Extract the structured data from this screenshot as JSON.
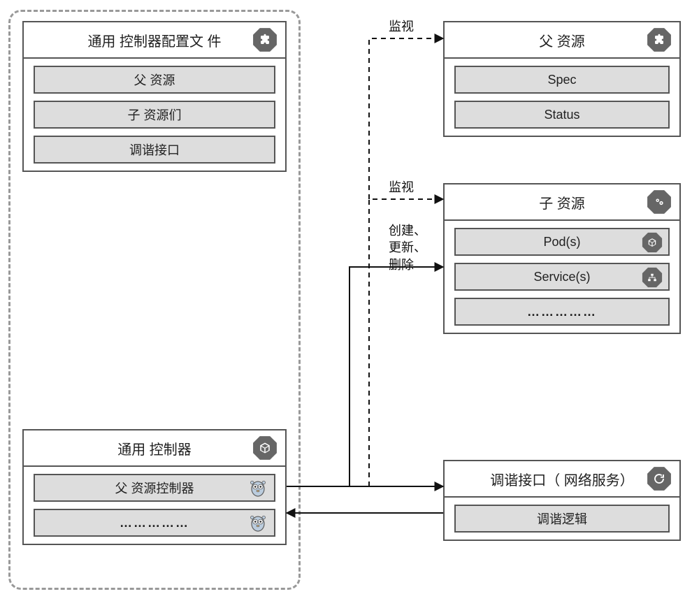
{
  "left": {
    "config_box": {
      "title": "通用 控制器配置文 件",
      "items": [
        "父 资源",
        "子 资源们",
        "调谐接口"
      ],
      "icon": "puzzle-icon"
    },
    "controller_box": {
      "title": "通用 控制器",
      "items": [
        "父 资源控制器",
        "……………"
      ],
      "icon": "cube-icon",
      "item_icon": "gopher-icon"
    }
  },
  "right": {
    "parent_box": {
      "title": "父 资源",
      "items": [
        "Spec",
        "Status"
      ],
      "icon": "puzzle-icon"
    },
    "child_box": {
      "title": "子 资源",
      "items": [
        "Pod(s)",
        "Service(s)",
        "……………"
      ],
      "icon": "gear-icon",
      "item_icons": [
        "cube-icon",
        "sitemap-icon",
        null
      ]
    },
    "tuning_box": {
      "title": "调谐接口（ 网络服务）",
      "items": [
        "调谐逻辑"
      ],
      "icon": "refresh-icon"
    }
  },
  "edges": {
    "watch_parent": "监视",
    "watch_child": "监视",
    "crud_child": "创建、\n更新、\n删除"
  },
  "chart_data": {
    "type": "diagram",
    "nodes": [
      {
        "id": "config",
        "label": "通用控制器配置文件",
        "fields": [
          "父资源",
          "子资源们",
          "调谐接口"
        ]
      },
      {
        "id": "controller",
        "label": "通用控制器",
        "fields": [
          "父资源控制器",
          "…"
        ]
      },
      {
        "id": "parent_res",
        "label": "父资源",
        "fields": [
          "Spec",
          "Status"
        ]
      },
      {
        "id": "child_res",
        "label": "子资源",
        "fields": [
          "Pod(s)",
          "Service(s)",
          "…"
        ]
      },
      {
        "id": "tuning_if",
        "label": "调谐接口（网络服务）",
        "fields": [
          "调谐逻辑"
        ]
      }
    ],
    "container": {
      "id": "dashed_group",
      "children": [
        "config",
        "controller"
      ]
    },
    "edges": [
      {
        "from": "controller",
        "to": "parent_res",
        "label": "监视",
        "style": "dashed",
        "direction": "forward"
      },
      {
        "from": "controller",
        "to": "child_res",
        "label": "监视",
        "style": "dashed",
        "direction": "forward"
      },
      {
        "from": "controller",
        "to": "child_res",
        "label": "创建、更新、删除",
        "style": "solid",
        "direction": "forward"
      },
      {
        "from": "controller",
        "to": "tuning_if",
        "label": "",
        "style": "solid",
        "direction": "both"
      }
    ]
  }
}
